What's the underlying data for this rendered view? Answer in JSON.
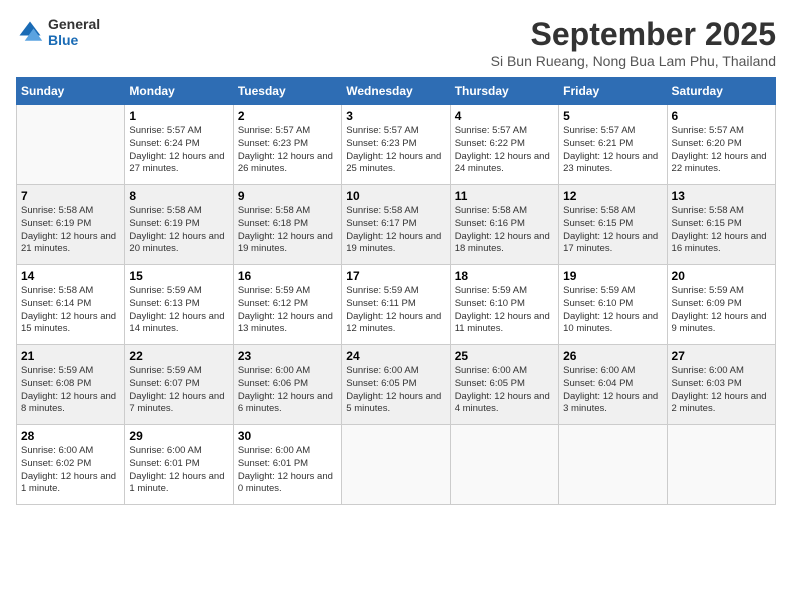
{
  "logo": {
    "text_general": "General",
    "text_blue": "Blue"
  },
  "title": "September 2025",
  "subtitle": "Si Bun Rueang, Nong Bua Lam Phu, Thailand",
  "weekdays": [
    "Sunday",
    "Monday",
    "Tuesday",
    "Wednesday",
    "Thursday",
    "Friday",
    "Saturday"
  ],
  "weeks": [
    [
      {
        "day": "",
        "sunrise": "",
        "sunset": "",
        "daylight": ""
      },
      {
        "day": "1",
        "sunrise": "Sunrise: 5:57 AM",
        "sunset": "Sunset: 6:24 PM",
        "daylight": "Daylight: 12 hours and 27 minutes."
      },
      {
        "day": "2",
        "sunrise": "Sunrise: 5:57 AM",
        "sunset": "Sunset: 6:23 PM",
        "daylight": "Daylight: 12 hours and 26 minutes."
      },
      {
        "day": "3",
        "sunrise": "Sunrise: 5:57 AM",
        "sunset": "Sunset: 6:23 PM",
        "daylight": "Daylight: 12 hours and 25 minutes."
      },
      {
        "day": "4",
        "sunrise": "Sunrise: 5:57 AM",
        "sunset": "Sunset: 6:22 PM",
        "daylight": "Daylight: 12 hours and 24 minutes."
      },
      {
        "day": "5",
        "sunrise": "Sunrise: 5:57 AM",
        "sunset": "Sunset: 6:21 PM",
        "daylight": "Daylight: 12 hours and 23 minutes."
      },
      {
        "day": "6",
        "sunrise": "Sunrise: 5:57 AM",
        "sunset": "Sunset: 6:20 PM",
        "daylight": "Daylight: 12 hours and 22 minutes."
      }
    ],
    [
      {
        "day": "7",
        "sunrise": "Sunrise: 5:58 AM",
        "sunset": "Sunset: 6:19 PM",
        "daylight": "Daylight: 12 hours and 21 minutes."
      },
      {
        "day": "8",
        "sunrise": "Sunrise: 5:58 AM",
        "sunset": "Sunset: 6:19 PM",
        "daylight": "Daylight: 12 hours and 20 minutes."
      },
      {
        "day": "9",
        "sunrise": "Sunrise: 5:58 AM",
        "sunset": "Sunset: 6:18 PM",
        "daylight": "Daylight: 12 hours and 19 minutes."
      },
      {
        "day": "10",
        "sunrise": "Sunrise: 5:58 AM",
        "sunset": "Sunset: 6:17 PM",
        "daylight": "Daylight: 12 hours and 19 minutes."
      },
      {
        "day": "11",
        "sunrise": "Sunrise: 5:58 AM",
        "sunset": "Sunset: 6:16 PM",
        "daylight": "Daylight: 12 hours and 18 minutes."
      },
      {
        "day": "12",
        "sunrise": "Sunrise: 5:58 AM",
        "sunset": "Sunset: 6:15 PM",
        "daylight": "Daylight: 12 hours and 17 minutes."
      },
      {
        "day": "13",
        "sunrise": "Sunrise: 5:58 AM",
        "sunset": "Sunset: 6:15 PM",
        "daylight": "Daylight: 12 hours and 16 minutes."
      }
    ],
    [
      {
        "day": "14",
        "sunrise": "Sunrise: 5:58 AM",
        "sunset": "Sunset: 6:14 PM",
        "daylight": "Daylight: 12 hours and 15 minutes."
      },
      {
        "day": "15",
        "sunrise": "Sunrise: 5:59 AM",
        "sunset": "Sunset: 6:13 PM",
        "daylight": "Daylight: 12 hours and 14 minutes."
      },
      {
        "day": "16",
        "sunrise": "Sunrise: 5:59 AM",
        "sunset": "Sunset: 6:12 PM",
        "daylight": "Daylight: 12 hours and 13 minutes."
      },
      {
        "day": "17",
        "sunrise": "Sunrise: 5:59 AM",
        "sunset": "Sunset: 6:11 PM",
        "daylight": "Daylight: 12 hours and 12 minutes."
      },
      {
        "day": "18",
        "sunrise": "Sunrise: 5:59 AM",
        "sunset": "Sunset: 6:10 PM",
        "daylight": "Daylight: 12 hours and 11 minutes."
      },
      {
        "day": "19",
        "sunrise": "Sunrise: 5:59 AM",
        "sunset": "Sunset: 6:10 PM",
        "daylight": "Daylight: 12 hours and 10 minutes."
      },
      {
        "day": "20",
        "sunrise": "Sunrise: 5:59 AM",
        "sunset": "Sunset: 6:09 PM",
        "daylight": "Daylight: 12 hours and 9 minutes."
      }
    ],
    [
      {
        "day": "21",
        "sunrise": "Sunrise: 5:59 AM",
        "sunset": "Sunset: 6:08 PM",
        "daylight": "Daylight: 12 hours and 8 minutes."
      },
      {
        "day": "22",
        "sunrise": "Sunrise: 5:59 AM",
        "sunset": "Sunset: 6:07 PM",
        "daylight": "Daylight: 12 hours and 7 minutes."
      },
      {
        "day": "23",
        "sunrise": "Sunrise: 6:00 AM",
        "sunset": "Sunset: 6:06 PM",
        "daylight": "Daylight: 12 hours and 6 minutes."
      },
      {
        "day": "24",
        "sunrise": "Sunrise: 6:00 AM",
        "sunset": "Sunset: 6:05 PM",
        "daylight": "Daylight: 12 hours and 5 minutes."
      },
      {
        "day": "25",
        "sunrise": "Sunrise: 6:00 AM",
        "sunset": "Sunset: 6:05 PM",
        "daylight": "Daylight: 12 hours and 4 minutes."
      },
      {
        "day": "26",
        "sunrise": "Sunrise: 6:00 AM",
        "sunset": "Sunset: 6:04 PM",
        "daylight": "Daylight: 12 hours and 3 minutes."
      },
      {
        "day": "27",
        "sunrise": "Sunrise: 6:00 AM",
        "sunset": "Sunset: 6:03 PM",
        "daylight": "Daylight: 12 hours and 2 minutes."
      }
    ],
    [
      {
        "day": "28",
        "sunrise": "Sunrise: 6:00 AM",
        "sunset": "Sunset: 6:02 PM",
        "daylight": "Daylight: 12 hours and 1 minute."
      },
      {
        "day": "29",
        "sunrise": "Sunrise: 6:00 AM",
        "sunset": "Sunset: 6:01 PM",
        "daylight": "Daylight: 12 hours and 1 minute."
      },
      {
        "day": "30",
        "sunrise": "Sunrise: 6:00 AM",
        "sunset": "Sunset: 6:01 PM",
        "daylight": "Daylight: 12 hours and 0 minutes."
      },
      {
        "day": "",
        "sunrise": "",
        "sunset": "",
        "daylight": ""
      },
      {
        "day": "",
        "sunrise": "",
        "sunset": "",
        "daylight": ""
      },
      {
        "day": "",
        "sunrise": "",
        "sunset": "",
        "daylight": ""
      },
      {
        "day": "",
        "sunrise": "",
        "sunset": "",
        "daylight": ""
      }
    ]
  ]
}
